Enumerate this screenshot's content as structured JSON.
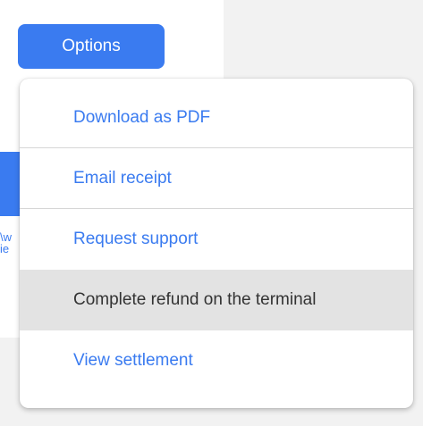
{
  "page": {
    "options_button_label": "Options",
    "peek_text_line1": "\\w",
    "peek_text_line2": "ie"
  },
  "menu": {
    "items": [
      {
        "label": "Download as PDF",
        "style": "link"
      },
      {
        "label": "Email receipt",
        "style": "link"
      },
      {
        "label": "Request support",
        "style": "link"
      },
      {
        "label": "Complete refund on the terminal",
        "style": "highlight"
      },
      {
        "label": "View settlement",
        "style": "link"
      }
    ]
  },
  "colors": {
    "accent": "#3a7bf0",
    "background": "#f2f2f2",
    "menu_background": "#ffffff",
    "highlight_background": "#e3e3e3",
    "highlight_text": "#333333",
    "divider": "#d6d6d6"
  }
}
